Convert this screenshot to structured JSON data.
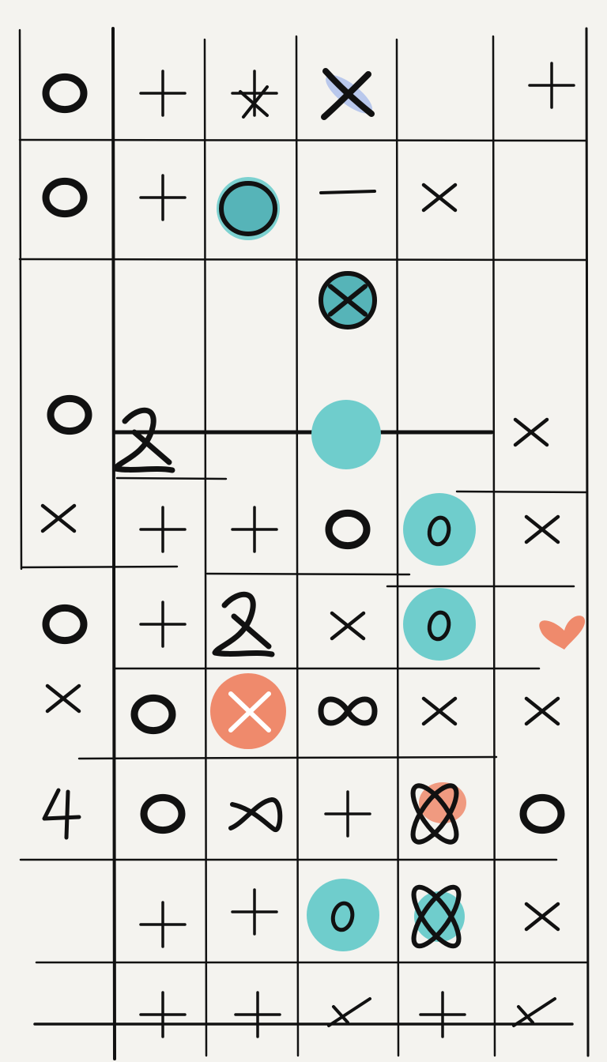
{
  "palette": {
    "background": "#f4f3ef",
    "ink": "#111111",
    "teal": "#56b4b8",
    "teal_light": "#6fcdcc",
    "coral": "#ef8a6c",
    "lavender": "#b9c8ec"
  },
  "grid": {
    "columns": 6,
    "rows": 11,
    "style": "hand-drawn"
  },
  "cells": [
    [
      "o",
      "+",
      "x-over-plus",
      "x-highlight-lavender",
      "",
      "+"
    ],
    [
      "o",
      "+",
      "o-filled-teal",
      "-",
      "x",
      ""
    ],
    [
      "",
      "",
      "",
      "x-in-teal-circle",
      "",
      ""
    ],
    [
      "o",
      "x-scribble",
      "",
      "teal-dot",
      "",
      "x"
    ],
    [
      "x",
      "+",
      "+",
      "o",
      "o-in-teal-circle",
      "x"
    ],
    [
      "o",
      "+",
      "x-scribble",
      "x",
      "o-in-teal-circle",
      "heart-coral"
    ],
    [
      "x",
      "o",
      "x-in-coral-circle",
      "infinity",
      "x",
      "x"
    ],
    [
      "4",
      "o",
      "x-loop",
      "+",
      "x-loop-coral",
      "o"
    ],
    [
      "",
      "+",
      "+",
      "o-in-teal-circle",
      "x-loop-teal",
      "x"
    ],
    [
      "",
      "+",
      "+",
      "x-crossed",
      "+",
      "x-crossed"
    ]
  ],
  "glyph_text": {
    "four": "4"
  }
}
